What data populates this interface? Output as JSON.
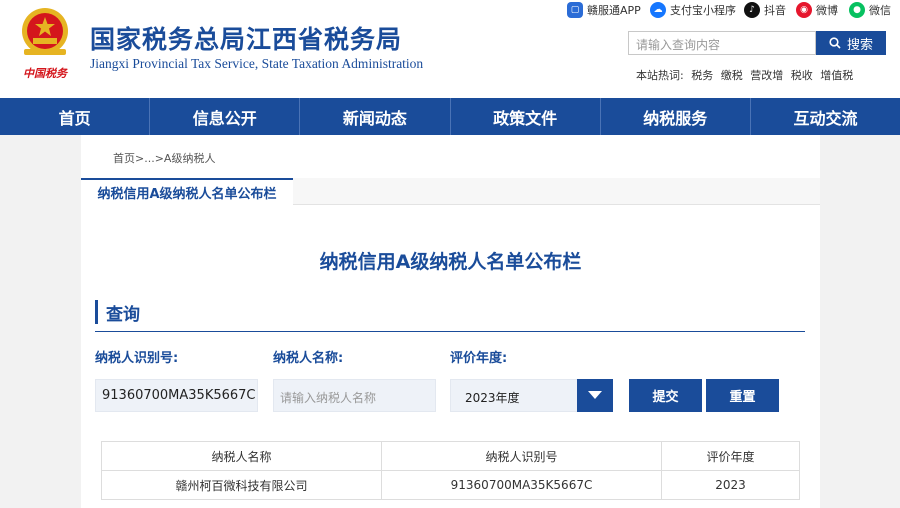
{
  "header": {
    "title": "国家税务总局江西省税务局",
    "subtitle": "Jiangxi Provincial Tax Service, State Taxation Administration",
    "emblem_text": "中国税务",
    "socials": [
      {
        "label": "赣服通APP",
        "icon": "app-icon",
        "color": "#2b6cd6"
      },
      {
        "label": "支付宝小程序",
        "icon": "cloud-icon",
        "color": "#1677ff"
      },
      {
        "label": "抖音",
        "icon": "tiktok-icon",
        "color": "#111111"
      },
      {
        "label": "微博",
        "icon": "weibo-icon",
        "color": "#e6162d"
      },
      {
        "label": "微信",
        "icon": "wechat-icon",
        "color": "#07c160"
      }
    ],
    "search": {
      "placeholder": "请输入查询内容",
      "button": "搜索"
    },
    "hot": {
      "label": "本站热词:",
      "words": [
        "税务",
        "缴税",
        "营改增",
        "税收",
        "增值税"
      ]
    }
  },
  "nav": [
    "首页",
    "信息公开",
    "新闻动态",
    "政策文件",
    "纳税服务",
    "互动交流"
  ],
  "breadcrumb": "首页>...>A级纳税人",
  "tab": "纳税信用A级纳税人名单公布栏",
  "page_title": "纳税信用A级纳税人名单公布栏",
  "query": {
    "heading": "查询",
    "taxpayer_id_label": "纳税人识别号:",
    "taxpayer_id_value": "91360700MA35K5667C",
    "taxpayer_name_label": "纳税人名称:",
    "taxpayer_name_placeholder": "请输入纳税人名称",
    "year_label": "评价年度:",
    "year_value": "2023年度",
    "submit": "提交",
    "reset": "重置"
  },
  "results": {
    "columns": [
      "纳税人名称",
      "纳税人识别号",
      "评价年度"
    ],
    "rows": [
      [
        "赣州柯百微科技有限公司",
        "91360700MA35K5667C",
        "2023"
      ]
    ]
  },
  "colors": {
    "primary": "#1a4c9a",
    "emblem_red": "#d4161c",
    "emblem_gold": "#e6b422"
  }
}
